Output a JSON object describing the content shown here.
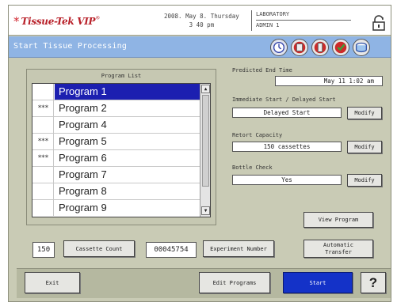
{
  "header": {
    "logo_text": "Tissue-Tek VIP",
    "logo_mark": "*",
    "date_line1": "2008. May 8. Thursday",
    "date_line2": "3 40 pm",
    "user_line1": "LABORATORY",
    "user_line2": "ADMIN 1",
    "lock_icon": "lock-icon"
  },
  "titlebar": {
    "title": "Start Tissue Processing",
    "status_icons": [
      "clock-status-icon",
      "reagent-status-icon",
      "bottle-status-icon",
      "check-status-icon",
      "retort-status-icon"
    ]
  },
  "program_list": {
    "title": "Program List",
    "items": [
      {
        "mark": "",
        "name": "Program 1",
        "selected": true
      },
      {
        "mark": "***",
        "name": "Program 2"
      },
      {
        "mark": "",
        "name": "Program 4"
      },
      {
        "mark": "***",
        "name": "Program 5"
      },
      {
        "mark": "***",
        "name": "Program 6"
      },
      {
        "mark": "",
        "name": "Program 7"
      },
      {
        "mark": "",
        "name": "Program 8"
      },
      {
        "mark": "",
        "name": "Program 9"
      }
    ]
  },
  "settings": {
    "predicted_end_label": "Predicted End Time",
    "predicted_end_value": "May 11 1:02 am",
    "start_label": "Immediate Start / Delayed Start",
    "start_value": "Delayed Start",
    "retort_label": "Retort Capacity",
    "retort_value": "150 cassettes",
    "bottle_label": "Bottle Check",
    "bottle_value": "Yes",
    "modify_label": "Modify",
    "view_program_label": "View Program",
    "automatic_transfer_label": "Automatic Transfer"
  },
  "counts": {
    "cassette_count_value": "150",
    "cassette_count_label": "Cassette Count",
    "experiment_number_value": "00045754",
    "experiment_number_label": "Experiment Number"
  },
  "bottom": {
    "exit_label": "Exit",
    "edit_programs_label": "Edit Programs",
    "start_label": "Start",
    "help_label": "?"
  }
}
